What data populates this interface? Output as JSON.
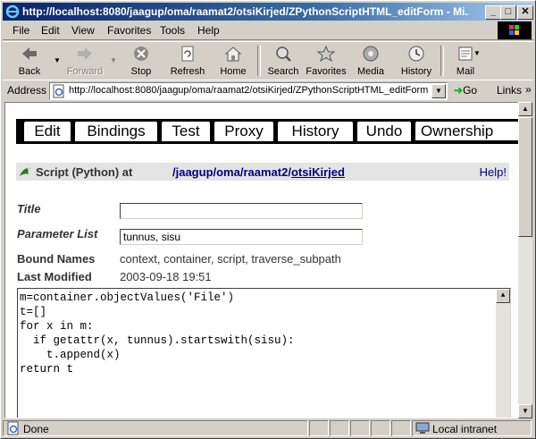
{
  "window": {
    "title": "http://localhost:8080/jaagup/oma/raamat2/otsiKirjed/ZPythonScriptHTML_editForm - Mi...",
    "minimize": "_",
    "maximize": "□",
    "close": "✕"
  },
  "menu": {
    "items": [
      "File",
      "Edit",
      "View",
      "Favorites",
      "Tools",
      "Help"
    ]
  },
  "toolbar": {
    "back": "Back",
    "forward": "Forward",
    "stop": "Stop",
    "refresh": "Refresh",
    "home": "Home",
    "search": "Search",
    "favorites": "Favorites",
    "media": "Media",
    "history": "History",
    "mail": "Mail"
  },
  "address": {
    "label": "Address",
    "url": "http://localhost:8080/jaagup/oma/raamat2/otsiKirjed/ZPythonScriptHTML_editForm",
    "go": "Go",
    "links": "Links",
    "more": "»"
  },
  "tabs": [
    "Edit",
    "Bindings",
    "Test",
    "Proxy",
    "History",
    "Undo",
    "Ownership"
  ],
  "script_header": {
    "type_label": "Script (Python) at",
    "path_prefix": "/jaagup/oma/raamat2/",
    "path_current": "otsiKirjed",
    "help": "Help!"
  },
  "form": {
    "title_label": "Title",
    "title_value": "",
    "params_label": "Parameter List",
    "params_value": "tunnus, sisu",
    "bound_label": "Bound Names",
    "bound_value": "context, container, script, traverse_subpath",
    "modified_label": "Last Modified",
    "modified_value": "2003-09-18 19:51"
  },
  "code": "m=container.objectValues('File')\nt=[]\nfor x in m:\n  if getattr(x, tunnus).startswith(sisu):\n    t.append(x)\nreturn t",
  "status": {
    "text": "Done",
    "zone": "Local intranet"
  },
  "colors": {
    "titlebar_start": "#0a246a",
    "link": "#000080",
    "chrome": "#d4d0c8"
  }
}
